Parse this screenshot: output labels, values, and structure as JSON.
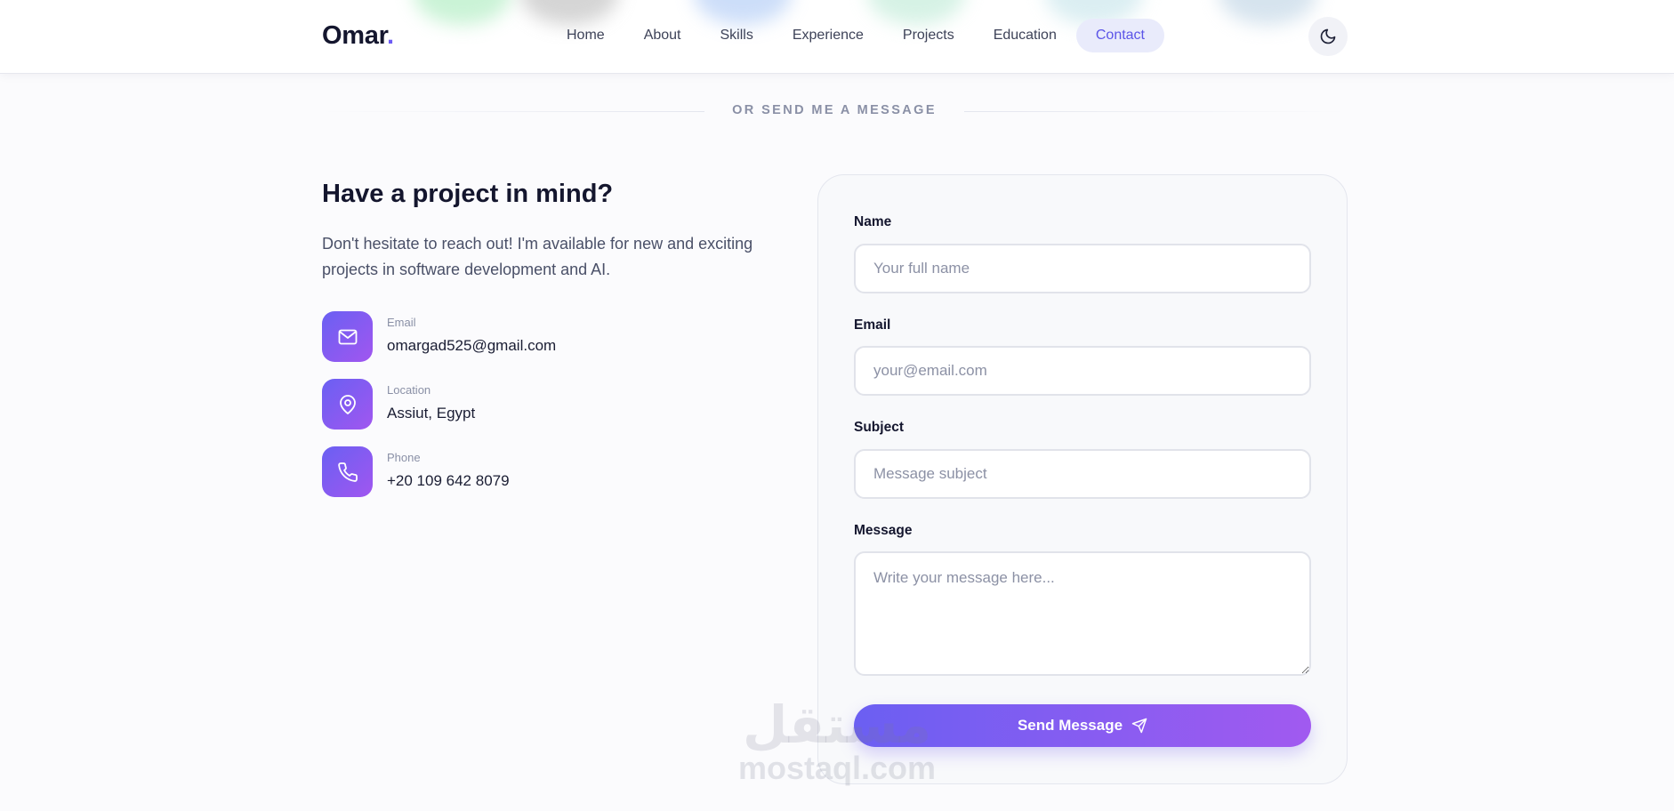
{
  "header": {
    "brand": "Omar",
    "brand_dot": ".",
    "nav": [
      {
        "label": "Home"
      },
      {
        "label": "About"
      },
      {
        "label": "Skills"
      },
      {
        "label": "Experience"
      },
      {
        "label": "Projects"
      },
      {
        "label": "Education"
      },
      {
        "label": "Contact"
      }
    ],
    "active_nav": "Contact",
    "theme_toggle_icon": "moon-icon"
  },
  "section": {
    "divider_text": "OR SEND ME A MESSAGE"
  },
  "info": {
    "title": "Have a project in mind?",
    "description": "Don't hesitate to reach out! I'm available for new and exciting projects in software development and AI.",
    "items": [
      {
        "icon": "mail-icon",
        "label": "Email",
        "value": "omargad525@gmail.com"
      },
      {
        "icon": "map-pin-icon",
        "label": "Location",
        "value": "Assiut, Egypt"
      },
      {
        "icon": "phone-icon",
        "label": "Phone",
        "value": "+20 109 642 8079"
      }
    ]
  },
  "form": {
    "name": {
      "label": "Name",
      "placeholder": "Your full name",
      "value": ""
    },
    "email": {
      "label": "Email",
      "placeholder": "your@email.com",
      "value": ""
    },
    "subject": {
      "label": "Subject",
      "placeholder": "Message subject",
      "value": ""
    },
    "message": {
      "label": "Message",
      "placeholder": "Write your message here...",
      "value": ""
    },
    "submit_label": "Send Message",
    "submit_icon": "send-icon"
  },
  "watermark": {
    "arabic": "مستقل",
    "latin": "mostaql.com"
  },
  "colors": {
    "accent": "#6d5cf5",
    "gradient_start": "#6b5ff2",
    "gradient_end": "#a15af0",
    "active_nav_bg": "#e9ebfb"
  }
}
